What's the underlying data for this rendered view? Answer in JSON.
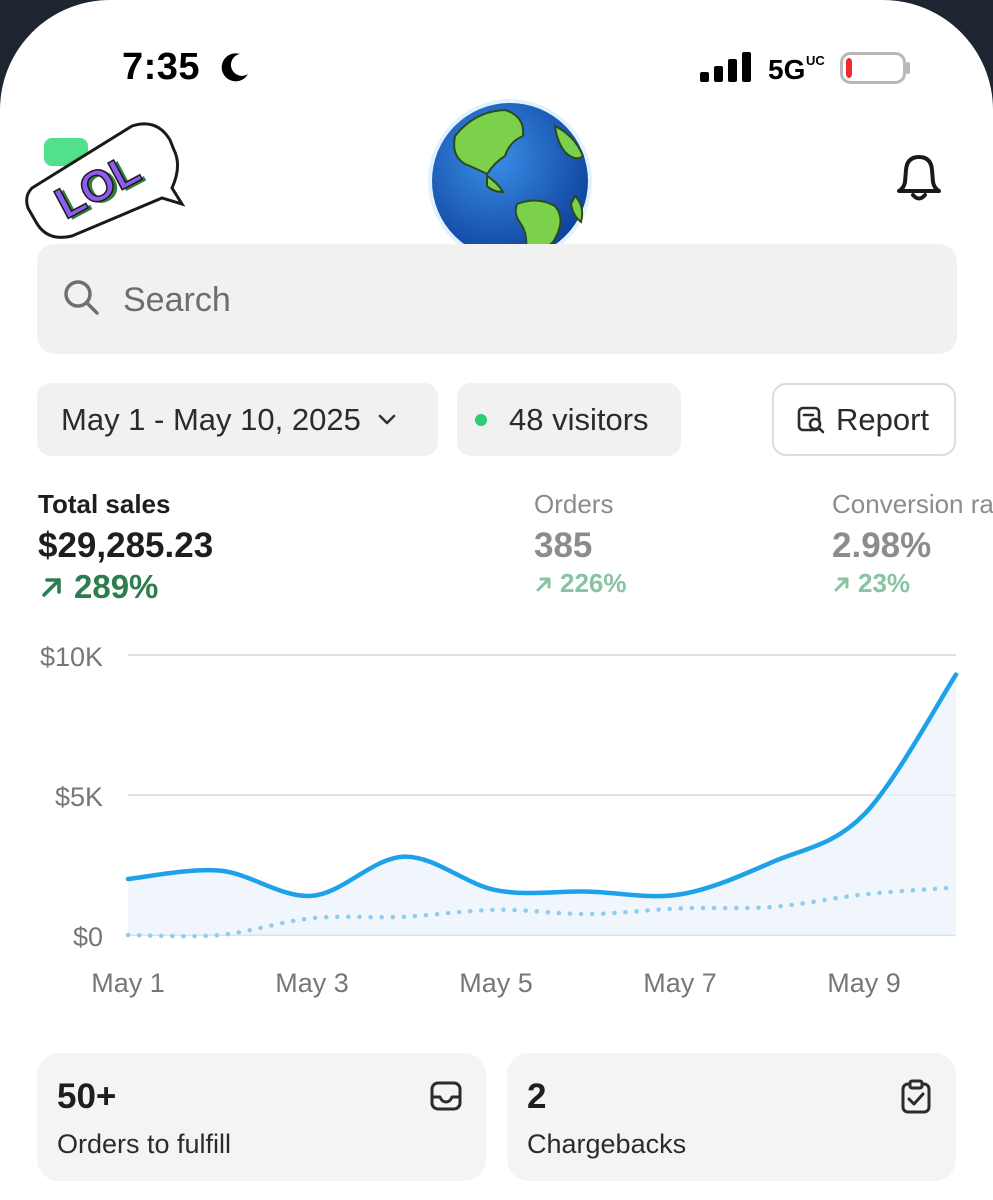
{
  "status_bar": {
    "time": "7:35",
    "network": "5G",
    "network_sub": "UC",
    "battery_level": 0.1
  },
  "header": {
    "left_sticker_text": "LOL"
  },
  "search": {
    "placeholder": "Search"
  },
  "filters": {
    "date_range": "May 1 - May 10, 2025",
    "visitors": "48 visitors",
    "report_label": "Report"
  },
  "metrics": [
    {
      "label": "Total sales",
      "value": "$29,285.23",
      "change": "289%"
    },
    {
      "label": "Orders",
      "value": "385",
      "change": "226%"
    },
    {
      "label": "Conversion rate",
      "value": "2.98%",
      "change": "23%"
    }
  ],
  "chart_data": {
    "type": "line",
    "x": [
      "May 1",
      "May 2",
      "May 3",
      "May 4",
      "May 5",
      "May 6",
      "May 7",
      "May 8",
      "May 9",
      "May 10"
    ],
    "xticks": [
      "May 1",
      "May 3",
      "May 5",
      "May 7",
      "May 9"
    ],
    "yticks": [
      "$10K",
      "$5K",
      "$0"
    ],
    "ylim": [
      0,
      10000
    ],
    "series": [
      {
        "style": "solid",
        "values": [
          2000,
          2300,
          1400,
          2800,
          1600,
          1550,
          1450,
          2600,
          4300,
          9300
        ]
      },
      {
        "style": "dotted",
        "values": [
          0,
          0,
          600,
          650,
          900,
          750,
          950,
          1000,
          1450,
          1700
        ]
      }
    ],
    "colors": {
      "line": "#1da1e8",
      "grid": "#e2e2e2",
      "fill": "#eaf2fb"
    }
  },
  "cards": [
    {
      "value": "50+",
      "label": "Orders to fulfill",
      "icon": "inbox-icon"
    },
    {
      "value": "2",
      "label": "Chargebacks",
      "icon": "clipboard-check-icon"
    }
  ],
  "colors": {
    "positive_strong": "#2e7d4f",
    "positive_muted": "#88c4a2",
    "live_dot": "#2ecc71"
  }
}
